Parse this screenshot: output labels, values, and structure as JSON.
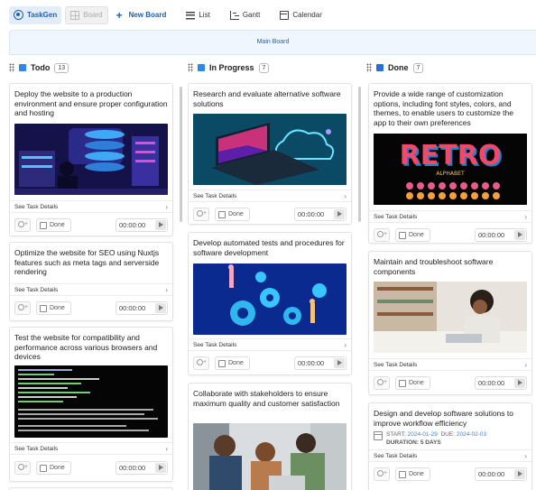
{
  "toolbar": {
    "items": [
      {
        "label": "TaskGen",
        "icon": "logo-icon"
      },
      {
        "label": "Board",
        "icon": "board-grid-icon"
      },
      {
        "label": "New Board",
        "icon": "plus-icon"
      },
      {
        "label": "List",
        "icon": "list-icon"
      },
      {
        "label": "Gantt",
        "icon": "gantt-icon"
      },
      {
        "label": "Calendar",
        "icon": "calendar-icon"
      }
    ]
  },
  "board": {
    "name": "Main Board"
  },
  "colors": {
    "accent": "#1e5fb8",
    "todo": "#2f87e8",
    "in_progress": "#2f87e8",
    "done": "#2a6fd6"
  },
  "common": {
    "details_label": "See Task Details",
    "done_label": "Done",
    "timer": "00:00:00",
    "start_label": "START:",
    "due_label": "DUE:",
    "duration_label": "DURATION:"
  },
  "columns": [
    {
      "title": "Todo",
      "count": "13",
      "cards": [
        {
          "title": "Deploy the website to a production environment and ensure proper configuration and hosting",
          "image": "server-room-illustration"
        },
        {
          "title": "Optimize the website for SEO using Nuxtjs features such as meta tags and serverside rendering"
        },
        {
          "title": "Test the website for compatibility and performance across various browsers and devices",
          "image": "terminal-screenshot"
        }
      ]
    },
    {
      "title": "In Progress",
      "count": "7",
      "cards": [
        {
          "title": "Research and evaluate alternative software solutions",
          "image": "laptop-cloud-illustration"
        },
        {
          "title": "Develop automated tests and procedures for software development",
          "image": "gears-illustration"
        },
        {
          "title": "Collaborate with stakeholders to ensure maximum quality and customer satisfaction",
          "image": "team-photo"
        }
      ]
    },
    {
      "title": "Done",
      "count": "7",
      "cards": [
        {
          "title": "Provide a wide range of customization options, including font styles, colors, and themes, to enable users to customize the app to their own preferences",
          "image": "retro-font-poster",
          "image_text": "RETRO",
          "image_subtext": "ALPHABET"
        },
        {
          "title": "Maintain and troubleshoot software components",
          "image": "office-worker-photo"
        },
        {
          "title": "Design and develop software solutions to improve workflow efficiency",
          "start": "2024-01-29",
          "due": "2024-02-03",
          "duration": "5 DAYS"
        }
      ]
    }
  ]
}
